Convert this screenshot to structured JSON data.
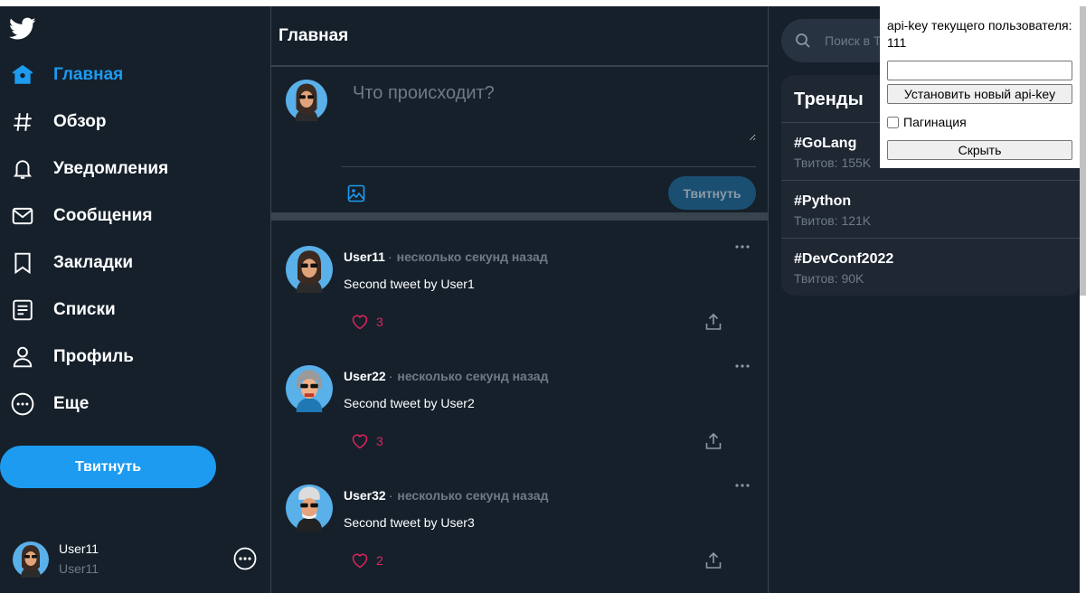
{
  "sidebar": {
    "nav": [
      {
        "label": "Главная",
        "icon": "home-icon",
        "active": true
      },
      {
        "label": "Обзор",
        "icon": "hashtag-icon"
      },
      {
        "label": "Уведомления",
        "icon": "bell-icon"
      },
      {
        "label": "Сообщения",
        "icon": "envelope-icon"
      },
      {
        "label": "Закладки",
        "icon": "bookmark-icon"
      },
      {
        "label": "Списки",
        "icon": "list-icon"
      },
      {
        "label": "Профиль",
        "icon": "profile-icon"
      },
      {
        "label": "Еще",
        "icon": "more-circle-icon"
      }
    ],
    "tweet_button": "Твитнуть",
    "user": {
      "name": "User11",
      "handle": "User11"
    }
  },
  "main": {
    "title": "Главная",
    "compose": {
      "placeholder": "Что происходит?",
      "submit": "Твитнуть"
    },
    "tweets": [
      {
        "author": "User11",
        "time": "несколько секунд назад",
        "text": "Second tweet by User1",
        "likes": "3"
      },
      {
        "author": "User22",
        "time": "несколько секунд назад",
        "text": "Second tweet by User2",
        "likes": "3"
      },
      {
        "author": "User32",
        "time": "несколько секунд назад",
        "text": "Second tweet by User3",
        "likes": "2"
      }
    ]
  },
  "right": {
    "search_placeholder": "Поиск в Твиттере",
    "trends_title": "Тренды",
    "trends": [
      {
        "tag": "#GoLang",
        "count": "Твитов: 155K"
      },
      {
        "tag": "#Python",
        "count": "Твитов: 121K"
      },
      {
        "tag": "#DevConf2022",
        "count": "Твитов: 90K"
      }
    ]
  },
  "popup": {
    "label_line1": "api-key текущего пользователя:",
    "label_line2": "111",
    "key_value": "",
    "set_button": "Установить новый api-key",
    "pagination_label": "Пагинация",
    "pagination_checked": false,
    "hide_button": "Скрыть"
  },
  "colors": {
    "accent": "#1d9bf0",
    "background": "#15202b",
    "like": "#e0245e"
  }
}
